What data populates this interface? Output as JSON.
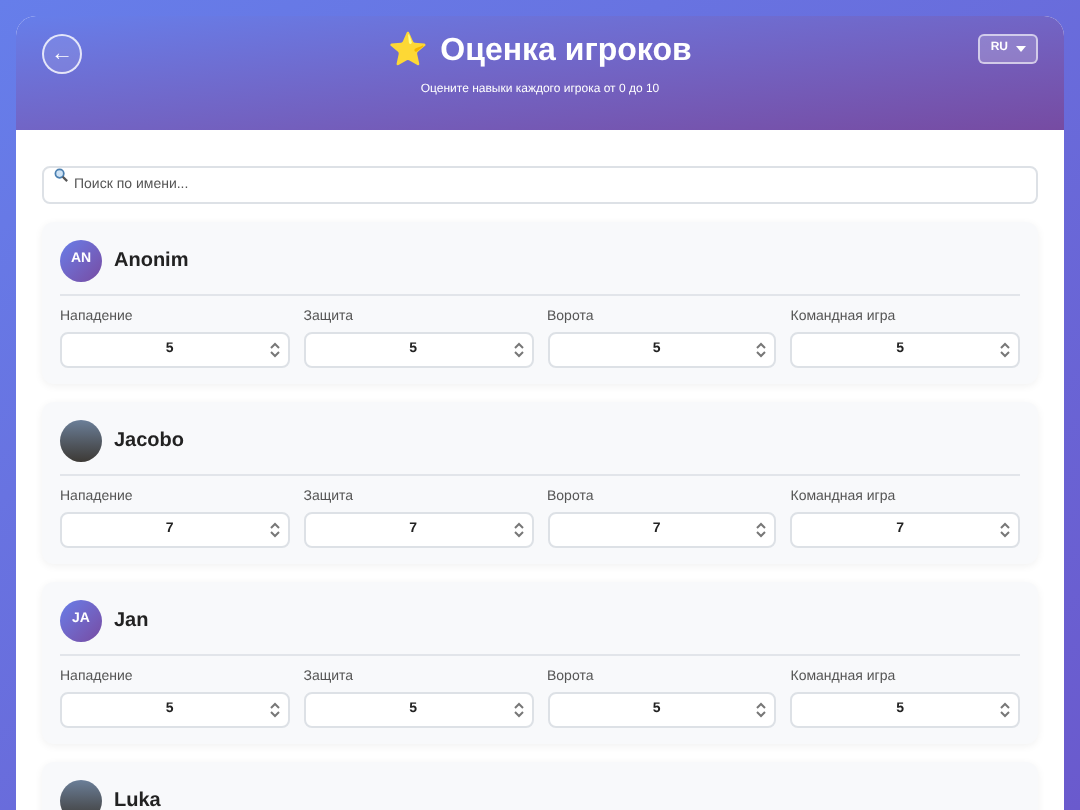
{
  "header": {
    "back_button": "←",
    "title_emoji": "⭐",
    "title": "Оценка игроков",
    "subtitle": "Оцените навыки каждого игрока от 0 до 10",
    "language": "RU"
  },
  "search": {
    "placeholder": "Поиск по имени..."
  },
  "players": [
    {
      "name": "Anonim",
      "avatar": {
        "kind": "initials",
        "text": "AN"
      },
      "ratings": [
        {
          "label": "Нападение",
          "value": "5"
        },
        {
          "label": "Защита",
          "value": "5"
        },
        {
          "label": "Ворота",
          "value": "5"
        },
        {
          "label": "Командная игра",
          "value": "5"
        }
      ]
    },
    {
      "name": "Jacobo",
      "avatar": {
        "kind": "photo"
      },
      "ratings": [
        {
          "label": "Нападение",
          "value": "7"
        },
        {
          "label": "Защита",
          "value": "7"
        },
        {
          "label": "Ворота",
          "value": "7"
        },
        {
          "label": "Командная игра",
          "value": "7"
        }
      ]
    },
    {
      "name": "Jan",
      "avatar": {
        "kind": "initials",
        "text": "JA"
      },
      "ratings": [
        {
          "label": "Нападение",
          "value": "5"
        },
        {
          "label": "Защита",
          "value": "5"
        },
        {
          "label": "Ворота",
          "value": "5"
        },
        {
          "label": "Командная игра",
          "value": "5"
        }
      ]
    },
    {
      "name": "Luka",
      "avatar": {
        "kind": "photo"
      }
    }
  ]
}
